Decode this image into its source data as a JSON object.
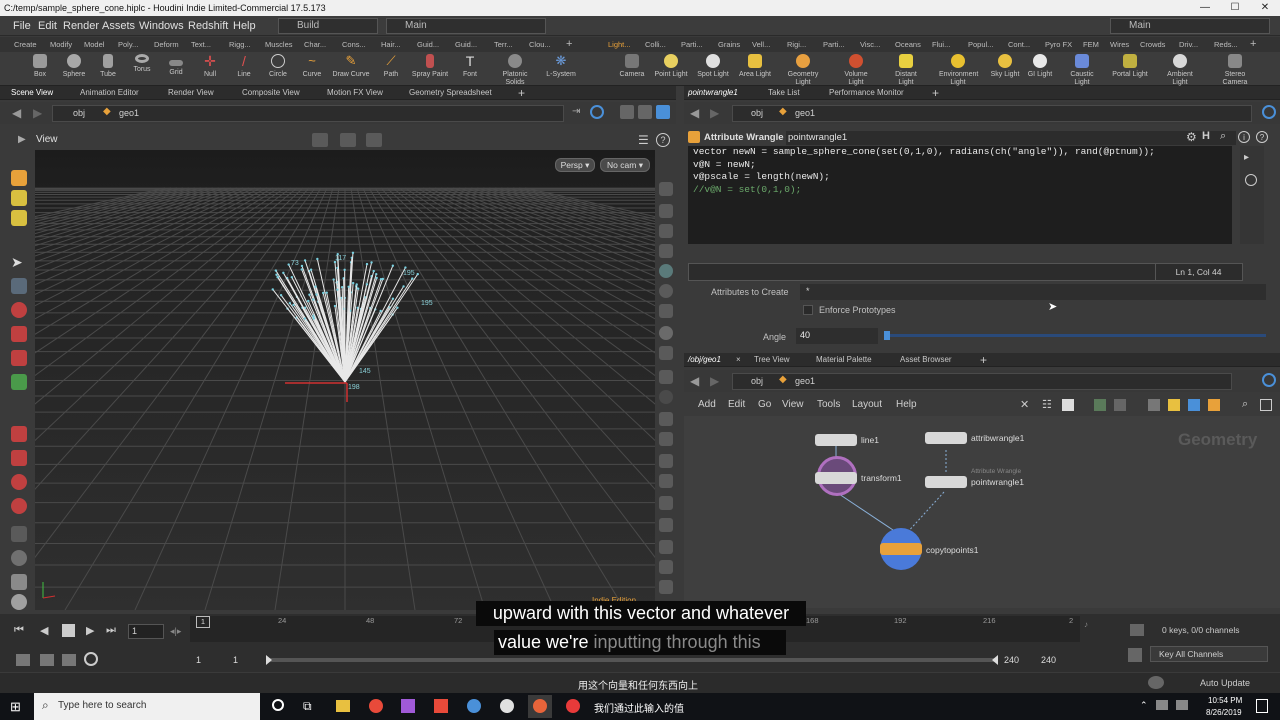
{
  "window": {
    "title": "C:/temp/sample_sphere_cone.hiplc - Houdini Indie Limited-Commercial 17.5.173",
    "controls": [
      "—",
      "☐",
      "✕"
    ]
  },
  "menubar": {
    "items": [
      "File",
      "Edit",
      "Render",
      "Assets",
      "Windows",
      "Redshift",
      "Help"
    ],
    "build_label": "Build",
    "desktop_left": "Main",
    "desktop_right": "Main"
  },
  "shelf_tabs_left": [
    "Create",
    "Modify",
    "Model",
    "Poly...",
    "Deform",
    "Text...",
    "Rigg...",
    "Muscles",
    "Char...",
    "Cons...",
    "Hair...",
    "Guid...",
    "Guid...",
    "Terr...",
    "Clou..."
  ],
  "shelf_tabs_right": [
    "Light...",
    "Colli...",
    "Parti...",
    "Grains",
    "Vell...",
    "Rigi...",
    "Parti...",
    "Visc...",
    "Oceans",
    "Flui...",
    "Popul...",
    "Cont...",
    "Pyro FX",
    "FEM",
    "Wires",
    "Crowds",
    "Driv...",
    "Reds..."
  ],
  "tools_left": [
    "Box",
    "Sphere",
    "Tube",
    "Torus",
    "Grid",
    "Null",
    "Line",
    "Circle",
    "Curve",
    "Draw Curve",
    "Path",
    "Spray Paint",
    "Font",
    "Platonic Solids",
    "L-System"
  ],
  "tools_right": [
    "Camera",
    "Point Light",
    "Spot Light",
    "Area Light",
    "Geometry Light",
    "Volume Light",
    "Distant Light",
    "Environment Light",
    "Sky Light",
    "GI Light",
    "Caustic Light",
    "Portal Light",
    "Ambient Light",
    "Stereo Camera"
  ],
  "viewer": {
    "tabs": [
      "Scene View",
      "Animation Editor",
      "Render View",
      "Composite View",
      "Motion FX View",
      "Geometry Spreadsheet"
    ],
    "path_obj": "obj",
    "path_geo": "geo1",
    "title": "View",
    "persp": "Persp",
    "cam": "No cam",
    "watermark": "Indie Edition",
    "point_labels": [
      "73",
      "117",
      "195",
      "195",
      "145",
      "198"
    ]
  },
  "param_pane": {
    "tabs": [
      "pointwrangle1",
      "Take List",
      "Performance Monitor"
    ],
    "path_obj": "obj",
    "path_geo": "geo1",
    "node_type": "Attribute Wrangle",
    "node_name": "pointwrangle1",
    "code_lines": [
      "vector newN = sample_sphere_cone(set(0,1,0), radians(ch(\"angle\")), rand(@ptnum));",
      "v@N = newN;",
      "v@pscale = length(newN);",
      "//v@N = set(0,1,0);"
    ],
    "cursor_pos": "Ln 1, Col 44",
    "attributes_to_create_label": "Attributes to Create",
    "attributes_to_create_value": "*",
    "enforce_prototypes_label": "Enforce Prototypes",
    "angle_label": "Angle",
    "angle_value": "40",
    "angle_fraction": 0.0
  },
  "network_pane": {
    "tabs": [
      "/obj/geo1",
      "Tree View",
      "Material Palette",
      "Asset Browser"
    ],
    "path_obj": "obj",
    "path_geo": "geo1",
    "menu": [
      "Add",
      "Edit",
      "Go",
      "View",
      "Tools",
      "Layout",
      "Help"
    ],
    "context_label": "Geometry",
    "nodes": [
      {
        "name": "line1"
      },
      {
        "name": "transform1"
      },
      {
        "name": "attribwrangle1"
      },
      {
        "name": "pointwrangle1",
        "subtitle": "Attribute Wrangle"
      },
      {
        "name": "copytopoints1"
      }
    ]
  },
  "timeline": {
    "current_frame": "1",
    "ticks": [
      "1",
      "24",
      "48",
      "72",
      "168",
      "192",
      "216",
      "2"
    ],
    "range_start": "1",
    "range_start2": "1",
    "range_end": "240",
    "range_end2": "240",
    "keys_info": "0 keys, 0/0 channels",
    "key_all": "Key All Channels",
    "auto_label": "Auto Update"
  },
  "subtitles": {
    "line1": "upward with this vector and whatever",
    "line2_a": "value we're",
    "line2_b": "inputting through this",
    "cn1": "用这个向量和任何东西向上",
    "cn2": "我们通过此输入的值"
  },
  "taskbar": {
    "search_placeholder": "Type here to search",
    "time": "10:54 PM",
    "date": "8/26/2019"
  },
  "colors": {
    "accent_orange": "#e8a13a",
    "highlight_blue": "#4a90d9",
    "node_purple": "#b070c0"
  }
}
